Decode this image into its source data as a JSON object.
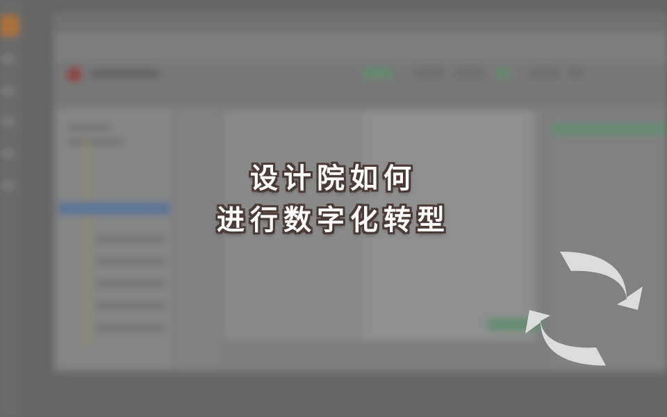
{
  "headline": {
    "line1": "设计院如何",
    "line2": "进行数字化转型"
  },
  "icons": {
    "transform": "refresh-arrows-icon"
  },
  "colors": {
    "background": "#6e6e6e",
    "headline_text": "#ffffff",
    "headline_outline": "#4b3b37",
    "icon_fill": "#e4e4e4",
    "accent_orange": "#c27a3c",
    "accent_green": "#6e9a7e"
  }
}
